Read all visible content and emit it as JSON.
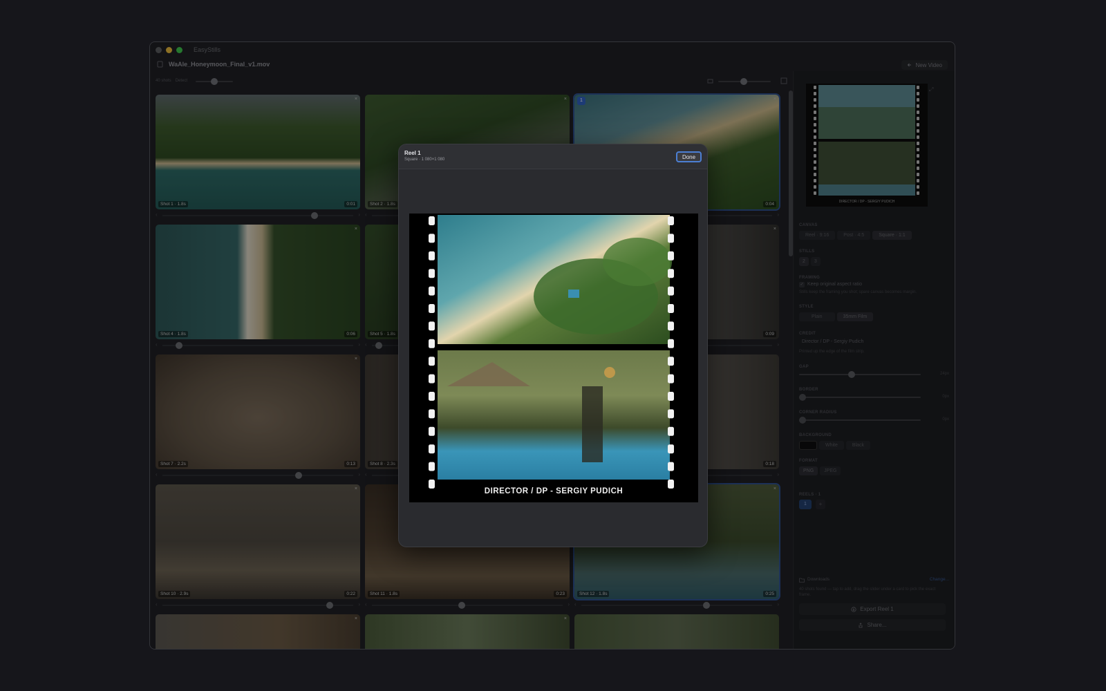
{
  "app": {
    "name": "EasyStills",
    "file_name": "WaAle_Honeymoon_Final_v1.mov",
    "new_video_label": "New Video",
    "shots_count": "40 shots",
    "detect_label": "Detect"
  },
  "shots": [
    {
      "caption": "Shot 1 · 1.8s",
      "duration": "0:01",
      "selected": false,
      "frame": 0.81
    },
    {
      "caption": "Shot 2 · 1.8s",
      "duration": "",
      "selected": false,
      "frame": 0.5
    },
    {
      "caption": "",
      "duration": "0:04",
      "selected": true,
      "badge": "1",
      "frame": 0.5
    },
    {
      "caption": "Shot 4 · 1.8s",
      "duration": "0:06",
      "selected": false,
      "frame": 0.07
    },
    {
      "caption": "Shot 5 · 1.8s",
      "duration": "",
      "selected": false,
      "frame": 0.02
    },
    {
      "caption": "",
      "duration": "0:09",
      "selected": false,
      "frame": 0.5
    },
    {
      "caption": "Shot 7 · 2.2s",
      "duration": "0:13",
      "selected": false,
      "frame": 0.72
    },
    {
      "caption": "Shot 8 · 2.3s",
      "duration": "",
      "selected": false,
      "frame": 0.5
    },
    {
      "caption": "",
      "duration": "0:18",
      "selected": false,
      "frame": 0.5
    },
    {
      "caption": "Shot 10 · 2.9s",
      "duration": "0:22",
      "selected": false,
      "frame": 0.89
    },
    {
      "caption": "Shot 11 · 1.8s",
      "duration": "0:23",
      "selected": false,
      "frame": 0.47
    },
    {
      "caption": "Shot 12 · 1.8s",
      "duration": "0:25",
      "selected": true,
      "frame": 0.66
    }
  ],
  "sidebar": {
    "canvas_label": "CANVAS",
    "canvas_options": [
      "Reel · 9:16",
      "Post · 4:5",
      "Square · 1:1"
    ],
    "stills_label": "STILLS",
    "stills_options": [
      "2",
      "3"
    ],
    "framing_label": "FRAMING",
    "keep_ratio_label": "Keep original aspect ratio",
    "framing_hint": "Stills keep the framing you shot; spare canvas becomes margin.",
    "style_label": "STYLE",
    "style_options": [
      "Plain",
      "35mm Film"
    ],
    "credit_label": "CREDIT",
    "credit_value": "Director / DP - Sergiy Pudich",
    "credit_hint": "Printed up the edge of the film strip.",
    "gap_label": "GAP",
    "gap_value": "24px",
    "gap_level": 0.43,
    "border_label": "BORDER",
    "border_value": "0px",
    "corner_label": "CORNER RADIUS",
    "corner_value": "0px",
    "background_label": "BACKGROUND",
    "background_options": [
      "White",
      "Black"
    ],
    "format_label": "FORMAT",
    "format_options": [
      "PNG",
      "JPEG"
    ],
    "reels_label": "REELS · 1",
    "reel_number": "1",
    "add_reel": "+",
    "downloads_label": "Downloads",
    "change_label": "Change...",
    "downloads_hint": "40 shots found — tap to add, drag the slider under a card to pick the exact frame.",
    "export_label": "Export Reel 1",
    "share_label": "Share...",
    "preview_credit": "DIRECTOR / DP - SERGIY PUDICH"
  },
  "modal": {
    "title": "Reel 1",
    "subtitle": "Square · 1 080×1 080",
    "done_label": "Done",
    "credit": "DIRECTOR / DP - SERGIY PUDICH"
  },
  "colors": {
    "accent": "#4c7fd4",
    "selected": "#2e4f8f",
    "window": "#1f2024"
  }
}
